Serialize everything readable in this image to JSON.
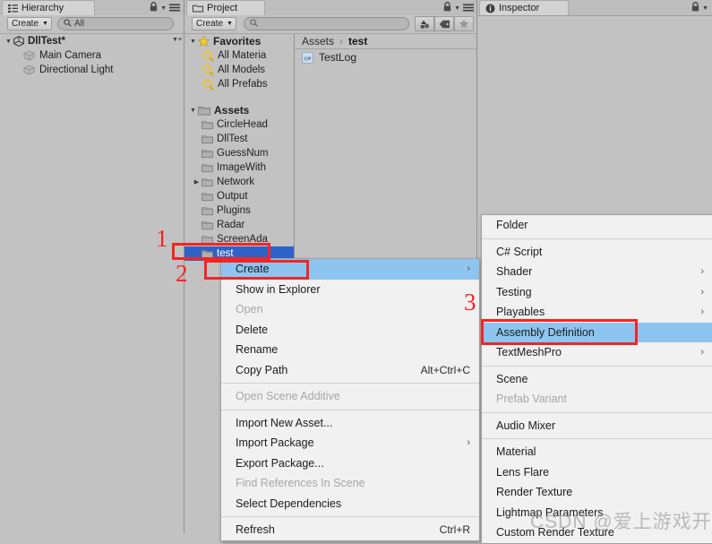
{
  "hierarchy": {
    "tab_label": "Hierarchy",
    "tab_icon": "hierarchy-icon",
    "create_label": "Create",
    "search_placeholder": "All",
    "search_value": "All",
    "root": {
      "label": "DllTest*",
      "icon": "unity-scene-icon"
    },
    "items": [
      {
        "label": "Main Camera",
        "icon": "gameobject-icon"
      },
      {
        "label": "Directional Light",
        "icon": "gameobject-icon"
      }
    ]
  },
  "project": {
    "tab_label": "Project",
    "tab_icon": "folder-icon",
    "create_label": "Create",
    "search_placeholder": "",
    "toolbar_icons": [
      "shapes-filter-icon",
      "label-tag-icon",
      "star-icon"
    ],
    "favorites": {
      "label": "Favorites",
      "icon": "star-icon",
      "items": [
        {
          "label": "All Materia",
          "icon": "search-icon"
        },
        {
          "label": "All Models",
          "icon": "search-icon"
        },
        {
          "label": "All Prefabs",
          "icon": "search-icon"
        }
      ]
    },
    "assets": {
      "label": "Assets",
      "items": [
        {
          "label": "CircleHead",
          "expandable": false,
          "selected": false
        },
        {
          "label": "DllTest",
          "expandable": false,
          "selected": false
        },
        {
          "label": "GuessNum",
          "expandable": false,
          "selected": false
        },
        {
          "label": "ImageWith",
          "expandable": false,
          "selected": false
        },
        {
          "label": "Network",
          "expandable": true,
          "selected": false
        },
        {
          "label": "Output",
          "expandable": false,
          "selected": false
        },
        {
          "label": "Plugins",
          "expandable": false,
          "selected": false
        },
        {
          "label": "Radar",
          "expandable": false,
          "selected": false
        },
        {
          "label": "ScreenAda",
          "expandable": false,
          "selected": false
        },
        {
          "label": "test",
          "expandable": false,
          "selected": true
        }
      ]
    },
    "breadcrumb": {
      "root": "Assets",
      "separator": "›",
      "current": "test"
    },
    "content_items": [
      {
        "label": "TestLog",
        "icon": "csharp-script-icon"
      }
    ]
  },
  "inspector": {
    "tab_label": "Inspector",
    "tab_icon": "info-icon"
  },
  "context_menu": {
    "items": [
      {
        "label": "Create",
        "selected": true,
        "submenu": true,
        "disabled": false,
        "accel": ""
      },
      {
        "label": "Show in Explorer",
        "selected": false,
        "submenu": false,
        "disabled": false,
        "accel": ""
      },
      {
        "label": "Open",
        "selected": false,
        "submenu": false,
        "disabled": true,
        "accel": ""
      },
      {
        "label": "Delete",
        "selected": false,
        "submenu": false,
        "disabled": false,
        "accel": ""
      },
      {
        "label": "Rename",
        "selected": false,
        "submenu": false,
        "disabled": false,
        "accel": ""
      },
      {
        "label": "Copy Path",
        "selected": false,
        "submenu": false,
        "disabled": false,
        "accel": "Alt+Ctrl+C"
      },
      {
        "separator": true
      },
      {
        "label": "Open Scene Additive",
        "selected": false,
        "submenu": false,
        "disabled": true,
        "accel": ""
      },
      {
        "separator": true
      },
      {
        "label": "Import New Asset...",
        "selected": false,
        "submenu": false,
        "disabled": false,
        "accel": ""
      },
      {
        "label": "Import Package",
        "selected": false,
        "submenu": true,
        "disabled": false,
        "accel": ""
      },
      {
        "label": "Export Package...",
        "selected": false,
        "submenu": false,
        "disabled": false,
        "accel": ""
      },
      {
        "label": "Find References In Scene",
        "selected": false,
        "submenu": false,
        "disabled": true,
        "accel": ""
      },
      {
        "label": "Select Dependencies",
        "selected": false,
        "submenu": false,
        "disabled": false,
        "accel": ""
      },
      {
        "separator": true
      },
      {
        "label": "Refresh",
        "selected": false,
        "submenu": false,
        "disabled": false,
        "accel": "Ctrl+R"
      }
    ]
  },
  "create_submenu": {
    "items": [
      {
        "label": "Folder",
        "selected": false,
        "submenu": false,
        "disabled": false
      },
      {
        "separator": true
      },
      {
        "label": "C# Script",
        "selected": false,
        "submenu": false,
        "disabled": false
      },
      {
        "label": "Shader",
        "selected": false,
        "submenu": true,
        "disabled": false
      },
      {
        "label": "Testing",
        "selected": false,
        "submenu": true,
        "disabled": false
      },
      {
        "label": "Playables",
        "selected": false,
        "submenu": true,
        "disabled": false
      },
      {
        "label": "Assembly Definition",
        "selected": true,
        "submenu": false,
        "disabled": false
      },
      {
        "label": "TextMeshPro",
        "selected": false,
        "submenu": true,
        "disabled": false
      },
      {
        "separator": true
      },
      {
        "label": "Scene",
        "selected": false,
        "submenu": false,
        "disabled": false
      },
      {
        "label": "Prefab Variant",
        "selected": false,
        "submenu": false,
        "disabled": true
      },
      {
        "separator": true
      },
      {
        "label": "Audio Mixer",
        "selected": false,
        "submenu": false,
        "disabled": false
      },
      {
        "separator": true
      },
      {
        "label": "Material",
        "selected": false,
        "submenu": false,
        "disabled": false
      },
      {
        "label": "Lens Flare",
        "selected": false,
        "submenu": false,
        "disabled": false
      },
      {
        "label": "Render Texture",
        "selected": false,
        "submenu": false,
        "disabled": false
      },
      {
        "label": "Lightmap Parameters",
        "selected": false,
        "submenu": false,
        "disabled": false
      },
      {
        "label": "Custom Render Texture",
        "selected": false,
        "submenu": false,
        "disabled": false
      }
    ]
  },
  "annotations": {
    "step1": "1",
    "step2": "2",
    "step3": "3",
    "accent_color": "#f22525"
  },
  "watermark": {
    "text": "CSDN @爱上游戏开发"
  }
}
